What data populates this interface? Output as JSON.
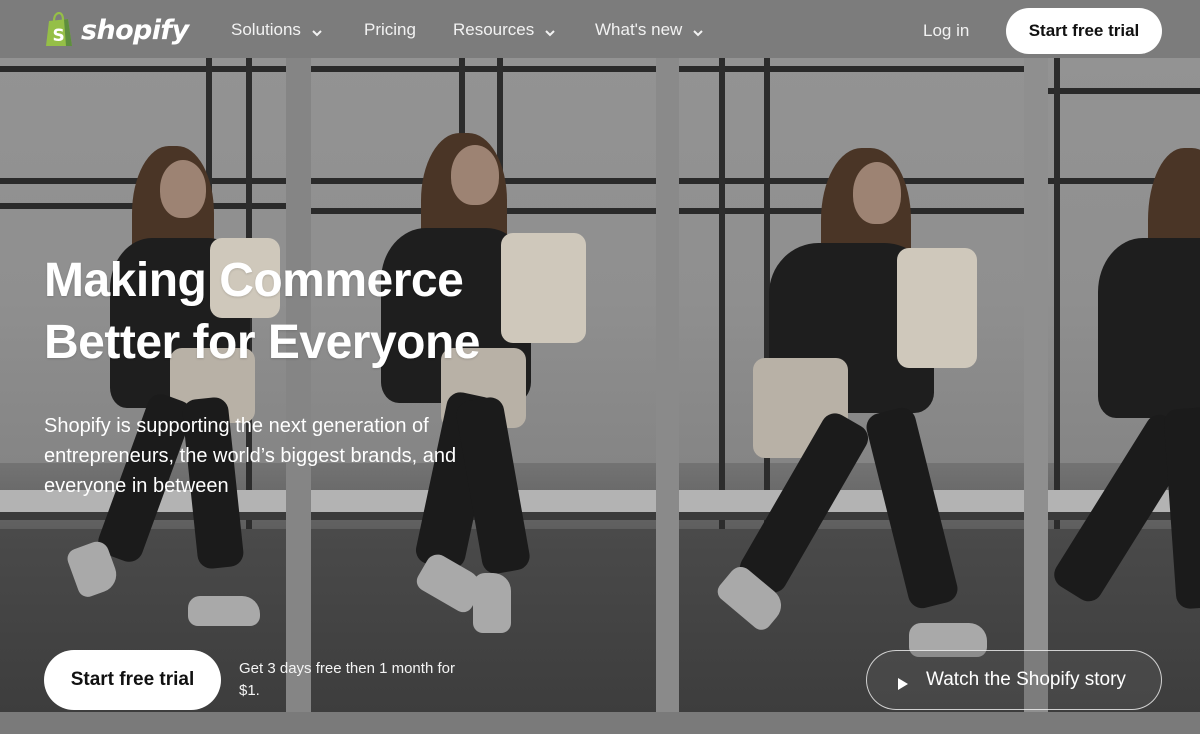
{
  "brand": {
    "name": "shopify",
    "accent_color": "#95bf47"
  },
  "nav": {
    "items": [
      {
        "label": "Solutions",
        "has_dropdown": true
      },
      {
        "label": "Pricing",
        "has_dropdown": false
      },
      {
        "label": "Resources",
        "has_dropdown": true
      },
      {
        "label": "What's new",
        "has_dropdown": true
      }
    ],
    "login_label": "Log in",
    "trial_label": "Start free trial"
  },
  "hero": {
    "title_line1": "Making Commerce",
    "title_line2": "Better for Everyone",
    "subtitle": "Shopify is supporting the next generation of entrepreneurs, the world’s biggest brands, and everyone in between"
  },
  "cta": {
    "trial_label": "Start free trial",
    "note": "Get 3 days free then 1 month for $1.",
    "story_label": "Watch the Shopify story",
    "story_icon": "play-icon"
  }
}
